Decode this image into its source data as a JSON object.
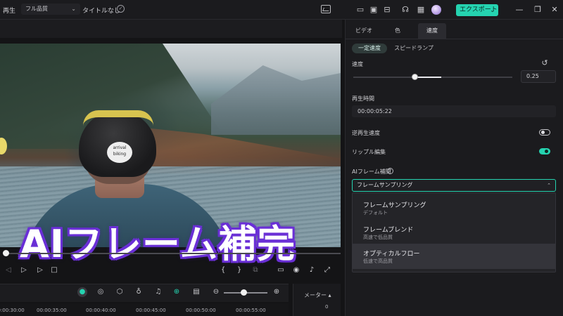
{
  "titlebar": {
    "title": "タイトルなし",
    "export_label": "エクスポート",
    "icons": [
      "layout-icon",
      "save-icon",
      "archive-icon",
      "headset-icon",
      "grid-icon",
      "avatar"
    ],
    "window_buttons": [
      "minimize-icon",
      "restore-icon",
      "close-icon"
    ]
  },
  "player": {
    "play_label": "再生",
    "quality": "フル品質",
    "overlay_caption": "AIフレーム補完"
  },
  "timeline": {
    "ruler": [
      "00:00:30:00",
      "00:00:35:00",
      "00:00:40:00",
      "00:00:45:00",
      "00:00:50:00",
      "00:00:55:00"
    ],
    "meter_label": "メーター",
    "meter_zero": "0"
  },
  "right_panel": {
    "tabs": [
      "ビデオ",
      "色",
      "速度"
    ],
    "active_tab": "速度",
    "subtabs": [
      "一定速度",
      "スピードランプ"
    ],
    "speed": {
      "label": "速度",
      "value": "0.25",
      "slider_fraction": 0.38
    },
    "duration": {
      "label": "再生時間",
      "value": "00:00:05:22"
    },
    "reverse": {
      "label": "逆再生速度",
      "on": false
    },
    "ripple": {
      "label": "リップル編集",
      "on": true
    },
    "interpolation": {
      "label": "AIフレーム補間",
      "selected": "フレームサンプリング",
      "options": [
        {
          "title": "フレームサンプリング",
          "subtitle": "デフォルト"
        },
        {
          "title": "フレームブレンド",
          "subtitle": "高速で低品質"
        },
        {
          "title": "オプティカルフロー",
          "subtitle": "低速で高品質"
        }
      ]
    }
  },
  "colors": {
    "accent": "#25d3b0",
    "caption_outline": "#6a2fd6"
  }
}
